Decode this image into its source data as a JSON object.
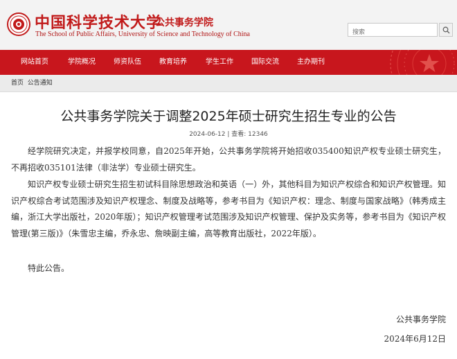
{
  "site": {
    "name_cn": "中国科学技术大学",
    "dept_cn": "公共事务学院",
    "name_en": "The School of Public Affairs, University of Science and Technology of China"
  },
  "search": {
    "placeholder": "搜索"
  },
  "nav": {
    "items": [
      {
        "label": "网站首页"
      },
      {
        "label": "学院概况"
      },
      {
        "label": "师资队伍"
      },
      {
        "label": "教育培养"
      },
      {
        "label": "学生工作"
      },
      {
        "label": "国际交流"
      },
      {
        "label": "主办期刊"
      }
    ]
  },
  "breadcrumb": {
    "home": "首页",
    "current": "公告通知"
  },
  "article": {
    "title": "公共事务学院关于调整2025年硕士研究生招生专业的公告",
    "meta": "2024-06-12 | 查看: 12346",
    "paragraphs": [
      "经学院研究决定，并报学校同意，自2025年开始，公共事务学院将开始招收035400知识产权专业硕士研究生，不再招收035101法律（非法学）专业硕士研究生。",
      "知识产权专业硕士研究生招生初试科目除思想政治和英语（一）外，其他科目为知识产权综合和知识产权管理。知识产权综合考试范围涉及知识产权理念、制度及战略等，参考书目为《知识产权：理念、制度与国家战略》（韩秀成主编，浙江大学出版社，2020年版）；知识产权管理考试范围涉及知识产权管理、保护及实务等，参考书目为《知识产权管理(第三版)》（朱雪忠主编，乔永忠、詹映副主编，高等教育出版社，2022年版）。",
      "特此公告。"
    ],
    "signature_org": "公共事务学院",
    "signature_date": "2024年6月12日"
  },
  "colors": {
    "brand_red": "#c8161d",
    "header_bg": "#f3f3f3"
  }
}
